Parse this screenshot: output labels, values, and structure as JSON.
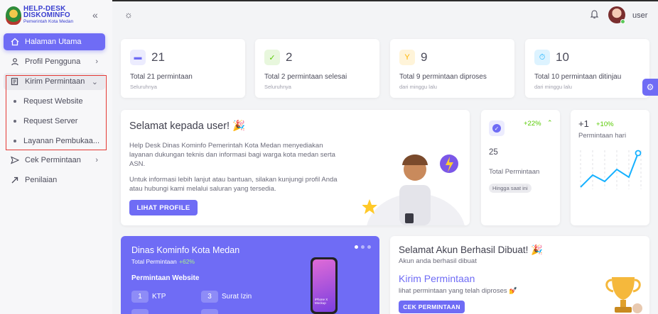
{
  "brand": {
    "line1": "HELP-DESK",
    "line2": "DISKOMINFO",
    "line3": "Pemerintah Kota Medan"
  },
  "sidebar": {
    "items": [
      {
        "label": "Halaman Utama",
        "icon": "home-icon"
      },
      {
        "label": "Profil Pengguna",
        "icon": "user-icon"
      },
      {
        "label": "Kirim Permintaan",
        "icon": "form-icon"
      },
      {
        "label": "Cek Permintaan",
        "icon": "send-icon"
      },
      {
        "label": "Penilaian",
        "icon": "external-icon"
      }
    ],
    "subitems": [
      "Request Website",
      "Request Server",
      "Layanan Pembukaa..."
    ]
  },
  "topbar": {
    "username": "user"
  },
  "stats": [
    {
      "value": "21",
      "label": "Total 21 permintaan",
      "sub": "Seluruhnya",
      "icon": "van-icon",
      "color": "#6f6cf5",
      "bg": "#ececfe"
    },
    {
      "value": "2",
      "label": "Total 2 permintaan selesai",
      "sub": "Seluruhnya",
      "icon": "check-icon",
      "color": "#56ca00",
      "bg": "#e8f7dd"
    },
    {
      "value": "9",
      "label": "Total 9 permintaan diproses",
      "sub": "dari minggu lalu",
      "icon": "fork-icon",
      "color": "#ffb400",
      "bg": "#fff4d9"
    },
    {
      "value": "10",
      "label": "Total 10 permintaan ditinjau",
      "sub": "dari minggu lalu",
      "icon": "timer-icon",
      "color": "#16b1ff",
      "bg": "#ddf3ff"
    }
  ],
  "welcome": {
    "title": "Selamat kepada user! 🎉",
    "p1": "Help Desk Dinas Kominfo Pemerintah Kota Medan menyediakan layanan dukungan teknis dan informasi bagi warga kota medan serta ASN.",
    "p2": "Untuk informasi lebih lanjut atau bantuan, silakan kunjungi profil Anda atau hubungi kami melalui saluran yang tersedia.",
    "button": "LIHAT PROFILE"
  },
  "total_card": {
    "percent": "+22%",
    "value": "25",
    "label": "Total Permintaan",
    "badge": "Hingga saat ini"
  },
  "daily_card": {
    "value": "+1",
    "percent": "+10%",
    "label": "Permintaan hari"
  },
  "dinas_card": {
    "title": "Dinas Kominfo Kota Medan",
    "sub_label": "Total Permintaan",
    "sub_percent": "+62%",
    "section": "Permintaan Website",
    "rows": [
      {
        "n": "1",
        "label": "KTP"
      },
      {
        "n": "3",
        "label": "Surat Izin"
      }
    ],
    "phone_text": "iPhone X Mockup"
  },
  "account_card": {
    "title": "Selamat Akun Berhasil Dibuat! 🎉",
    "sub": "Akun anda berhasil dibuat",
    "link": "Kirim Permintaan",
    "desc": "lihat permintaan yang telah diproses 💅",
    "button": "CEK PERMINTAAN"
  }
}
